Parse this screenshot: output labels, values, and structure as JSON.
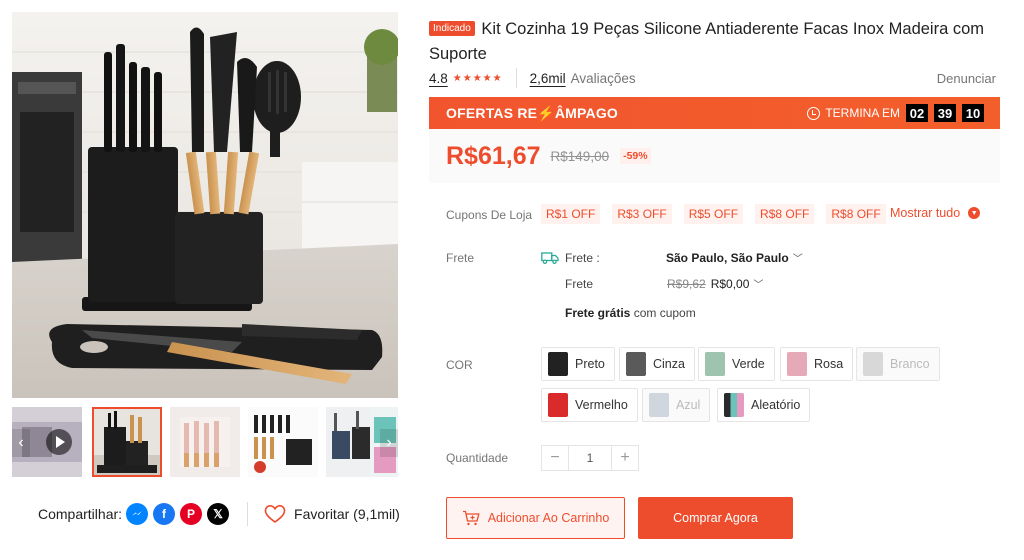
{
  "product": {
    "badge": "Indicado",
    "title": "Kit Cozinha 19 Peças Silicone Antiaderente Facas Inox Madeira com Suporte"
  },
  "rating": {
    "value": "4.8",
    "stars": "★★★★★",
    "reviews_count": "2,6mil",
    "reviews_label": "Avaliações",
    "report": "Denunciar"
  },
  "flash_sale": {
    "title_part1": "OFERTAS RE",
    "title_bolt": "⚡",
    "title_part2": "ÂMPAGO",
    "ends_label": "TERMINA EM",
    "hours": "02",
    "minutes": "39",
    "seconds": "10"
  },
  "price": {
    "current": "R$61,67",
    "original": "R$149,00",
    "discount": "-59%"
  },
  "coupons": {
    "label": "Cupons De Loja",
    "items": [
      "R$1 OFF",
      "R$3 OFF",
      "R$5 OFF",
      "R$8 OFF",
      "R$8 OFF"
    ],
    "show_all": "Mostrar tudo"
  },
  "shipping": {
    "label": "Frete",
    "row1_label": "Frete :",
    "destination": "São Paulo, São Paulo",
    "row2_label": "Frete",
    "old_price": "R$9,62",
    "new_price": "R$0,00",
    "free_bold": "Frete grátis",
    "free_rest": " com cupom"
  },
  "variants": {
    "label": "COR",
    "options": [
      {
        "name": "Preto",
        "color": "#222222",
        "disabled": false
      },
      {
        "name": "Cinza",
        "color": "#5a5a5a",
        "disabled": false
      },
      {
        "name": "Verde",
        "color": "#9fc4ae",
        "disabled": false
      },
      {
        "name": "Rosa",
        "color": "#e6a9b8",
        "disabled": false
      },
      {
        "name": "Branco",
        "color": "#cfcfcf",
        "disabled": true
      },
      {
        "name": "Vermelho",
        "color": "#d92b2b",
        "disabled": false
      },
      {
        "name": "Azul",
        "color": "#bcc6d2",
        "disabled": true
      },
      {
        "name": "Aleatório",
        "color": "#6a7c9a",
        "disabled": false
      }
    ]
  },
  "quantity": {
    "label": "Quantidade",
    "minus": "−",
    "value": "1",
    "plus": "+"
  },
  "actions": {
    "add_to_cart": "Adicionar Ao Carrinho",
    "buy_now": "Comprar Agora"
  },
  "share": {
    "label": "Compartilhar:",
    "favorite": "Favoritar (9,1mil)"
  },
  "colors": {
    "accent": "#ee4d2d",
    "timer_bg": "#000000",
    "muted": "#757575"
  }
}
